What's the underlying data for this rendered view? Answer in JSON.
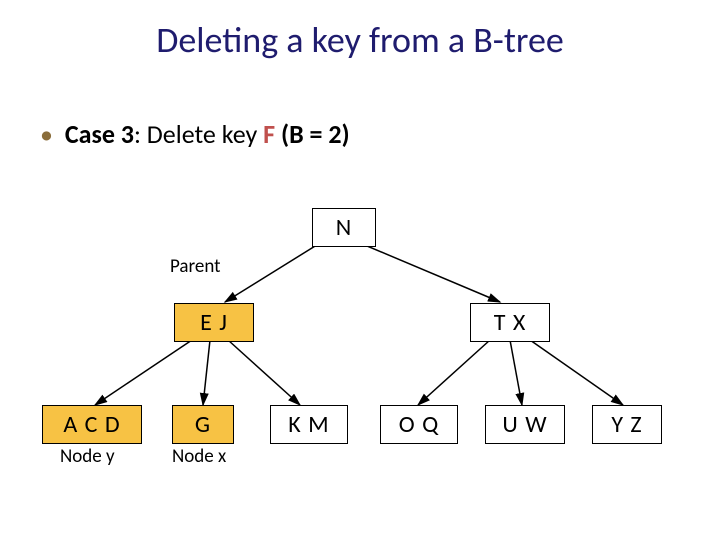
{
  "title": "Deleting a key from a B-tree",
  "bullet": {
    "case": "Case 3",
    "text1": ": Delete key ",
    "key": "F",
    "text2": "  (B = ",
    "bval": "2",
    "text3": ")"
  },
  "labels": {
    "parent": "Parent",
    "nodey": "Node y",
    "nodex": "Node x"
  },
  "nodes": {
    "root": "N",
    "left_child": "E  J",
    "right_child": "T  X",
    "leaf1": "A  C  D",
    "leaf2": "G",
    "leaf3": "K  M",
    "leaf4": "O  Q",
    "leaf5": "U  W",
    "leaf6": "Y  Z"
  }
}
